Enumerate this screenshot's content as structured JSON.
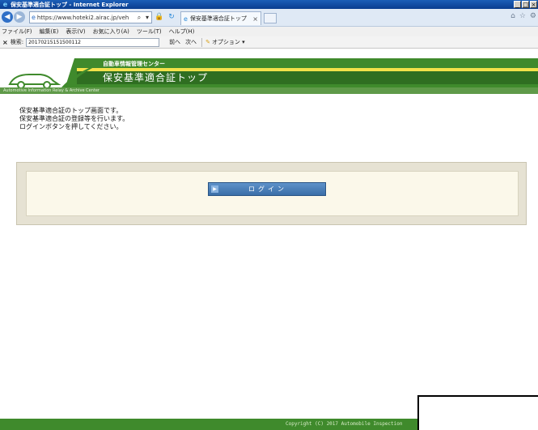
{
  "window": {
    "title": "保安基準適合証トップ - Internet Explorer",
    "min": "_",
    "max": "□",
    "close": "×"
  },
  "nav": {
    "url": "https://www.hoteki2.airac.jp/veh",
    "tab_title": "保安基準適合証トップ",
    "tab_close": "×"
  },
  "menu": [
    "ファイル(F)",
    "編集(E)",
    "表示(V)",
    "お気に入り(A)",
    "ツール(T)",
    "ヘルプ(H)"
  ],
  "searchbar": {
    "close": "×",
    "label": "検索:",
    "value": "20170215151500112",
    "prev": "前へ",
    "next": "次へ",
    "options": "オプション ▾"
  },
  "header": {
    "org": "自動車情報管理センター",
    "title": "保安基準適合証トップ",
    "subtitle": "Automotive Information Relay & Archive Center",
    "colors": {
      "green": "#3f8a2c",
      "yellow": "#f2e24a",
      "dark_green": "#2f6e21"
    }
  },
  "content": {
    "lines": [
      "保安基準適合証のトップ画面です。",
      "保安基準適合証の登録等を行います。",
      "ログインボタンを押してください。"
    ]
  },
  "login_button": {
    "label": "ログイン",
    "icon": "arrow-right-icon"
  },
  "footer": {
    "copyright": "Copyright (C) 2017 Automobile Inspection"
  }
}
